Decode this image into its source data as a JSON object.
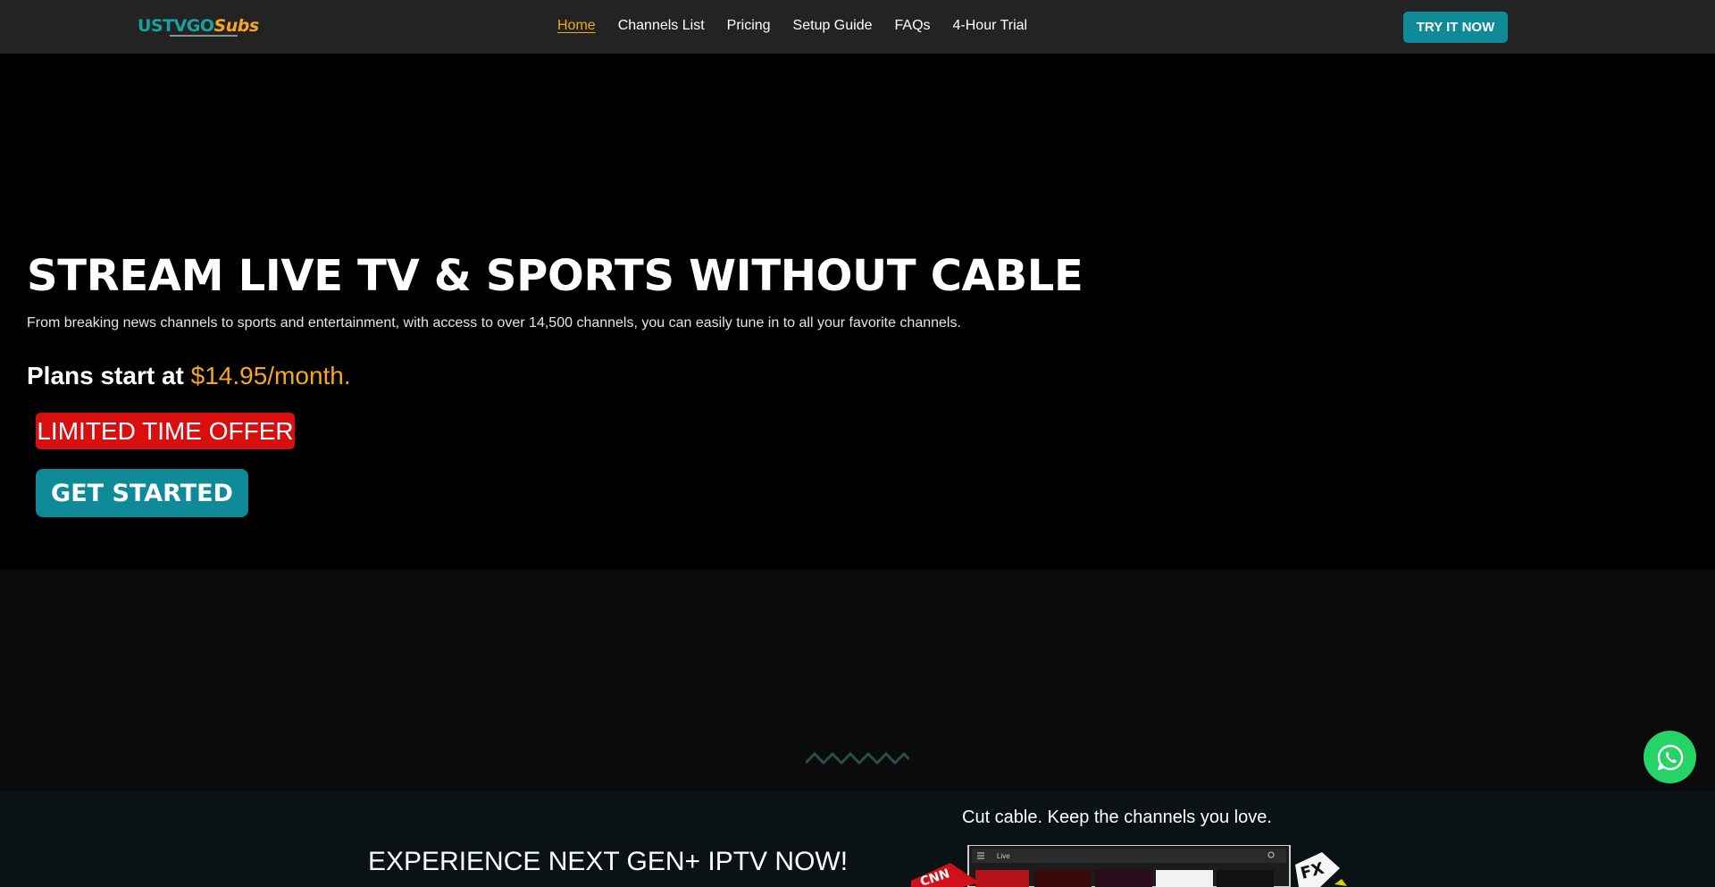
{
  "header": {
    "logo_us": "USTVGO",
    "logo_subs": "Subs",
    "nav": [
      {
        "label": "Home"
      },
      {
        "label": "Channels List"
      },
      {
        "label": "Pricing"
      },
      {
        "label": "Setup Guide"
      },
      {
        "label": "FAQs"
      },
      {
        "label": "4-Hour Trial"
      }
    ],
    "cta_label": "TRY IT NOW"
  },
  "hero": {
    "title": "STREAM LIVE TV & SPORTS WITHOUT CABLE",
    "subtitle": "From breaking news channels to sports and entertainment, with access to over 14,500 channels, you can easily tune in to all your favorite channels.",
    "plans_prefix": "Plans start at",
    "plans_price": "$14.95/month.",
    "offer": "LIMITED TIME OFFER",
    "cta": "GET STARTED"
  },
  "bottom": {
    "title": "EXPERIENCE NEXT GEN+ IPTV NOW!",
    "tagline": "Cut cable. Keep the channels you love.",
    "mock_search": "Live",
    "logos": [
      "CNN",
      "FX"
    ]
  },
  "colors": {
    "accent": "#0e8a99",
    "price": "#f5a623",
    "offer_bg": "#d80f0f",
    "whatsapp": "#25d366"
  },
  "icons": {
    "whatsapp": "whatsapp-icon",
    "divider": "wave-divider-icon"
  }
}
